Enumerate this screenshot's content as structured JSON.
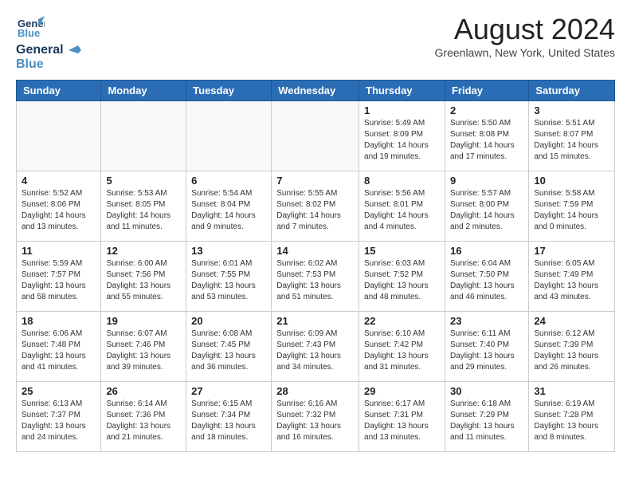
{
  "header": {
    "logo_line1": "General",
    "logo_line2": "Blue",
    "title": "August 2024",
    "subtitle": "Greenlawn, New York, United States"
  },
  "weekdays": [
    "Sunday",
    "Monday",
    "Tuesday",
    "Wednesday",
    "Thursday",
    "Friday",
    "Saturday"
  ],
  "weeks": [
    [
      {
        "day": "",
        "info": "",
        "empty": true
      },
      {
        "day": "",
        "info": "",
        "empty": true
      },
      {
        "day": "",
        "info": "",
        "empty": true
      },
      {
        "day": "",
        "info": "",
        "empty": true
      },
      {
        "day": "1",
        "info": "Sunrise: 5:49 AM\nSunset: 8:09 PM\nDaylight: 14 hours\nand 19 minutes."
      },
      {
        "day": "2",
        "info": "Sunrise: 5:50 AM\nSunset: 8:08 PM\nDaylight: 14 hours\nand 17 minutes."
      },
      {
        "day": "3",
        "info": "Sunrise: 5:51 AM\nSunset: 8:07 PM\nDaylight: 14 hours\nand 15 minutes."
      }
    ],
    [
      {
        "day": "4",
        "info": "Sunrise: 5:52 AM\nSunset: 8:06 PM\nDaylight: 14 hours\nand 13 minutes."
      },
      {
        "day": "5",
        "info": "Sunrise: 5:53 AM\nSunset: 8:05 PM\nDaylight: 14 hours\nand 11 minutes."
      },
      {
        "day": "6",
        "info": "Sunrise: 5:54 AM\nSunset: 8:04 PM\nDaylight: 14 hours\nand 9 minutes."
      },
      {
        "day": "7",
        "info": "Sunrise: 5:55 AM\nSunset: 8:02 PM\nDaylight: 14 hours\nand 7 minutes."
      },
      {
        "day": "8",
        "info": "Sunrise: 5:56 AM\nSunset: 8:01 PM\nDaylight: 14 hours\nand 4 minutes."
      },
      {
        "day": "9",
        "info": "Sunrise: 5:57 AM\nSunset: 8:00 PM\nDaylight: 14 hours\nand 2 minutes."
      },
      {
        "day": "10",
        "info": "Sunrise: 5:58 AM\nSunset: 7:59 PM\nDaylight: 14 hours\nand 0 minutes."
      }
    ],
    [
      {
        "day": "11",
        "info": "Sunrise: 5:59 AM\nSunset: 7:57 PM\nDaylight: 13 hours\nand 58 minutes."
      },
      {
        "day": "12",
        "info": "Sunrise: 6:00 AM\nSunset: 7:56 PM\nDaylight: 13 hours\nand 55 minutes."
      },
      {
        "day": "13",
        "info": "Sunrise: 6:01 AM\nSunset: 7:55 PM\nDaylight: 13 hours\nand 53 minutes."
      },
      {
        "day": "14",
        "info": "Sunrise: 6:02 AM\nSunset: 7:53 PM\nDaylight: 13 hours\nand 51 minutes."
      },
      {
        "day": "15",
        "info": "Sunrise: 6:03 AM\nSunset: 7:52 PM\nDaylight: 13 hours\nand 48 minutes."
      },
      {
        "day": "16",
        "info": "Sunrise: 6:04 AM\nSunset: 7:50 PM\nDaylight: 13 hours\nand 46 minutes."
      },
      {
        "day": "17",
        "info": "Sunrise: 6:05 AM\nSunset: 7:49 PM\nDaylight: 13 hours\nand 43 minutes."
      }
    ],
    [
      {
        "day": "18",
        "info": "Sunrise: 6:06 AM\nSunset: 7:48 PM\nDaylight: 13 hours\nand 41 minutes."
      },
      {
        "day": "19",
        "info": "Sunrise: 6:07 AM\nSunset: 7:46 PM\nDaylight: 13 hours\nand 39 minutes."
      },
      {
        "day": "20",
        "info": "Sunrise: 6:08 AM\nSunset: 7:45 PM\nDaylight: 13 hours\nand 36 minutes."
      },
      {
        "day": "21",
        "info": "Sunrise: 6:09 AM\nSunset: 7:43 PM\nDaylight: 13 hours\nand 34 minutes."
      },
      {
        "day": "22",
        "info": "Sunrise: 6:10 AM\nSunset: 7:42 PM\nDaylight: 13 hours\nand 31 minutes."
      },
      {
        "day": "23",
        "info": "Sunrise: 6:11 AM\nSunset: 7:40 PM\nDaylight: 13 hours\nand 29 minutes."
      },
      {
        "day": "24",
        "info": "Sunrise: 6:12 AM\nSunset: 7:39 PM\nDaylight: 13 hours\nand 26 minutes."
      }
    ],
    [
      {
        "day": "25",
        "info": "Sunrise: 6:13 AM\nSunset: 7:37 PM\nDaylight: 13 hours\nand 24 minutes."
      },
      {
        "day": "26",
        "info": "Sunrise: 6:14 AM\nSunset: 7:36 PM\nDaylight: 13 hours\nand 21 minutes."
      },
      {
        "day": "27",
        "info": "Sunrise: 6:15 AM\nSunset: 7:34 PM\nDaylight: 13 hours\nand 18 minutes."
      },
      {
        "day": "28",
        "info": "Sunrise: 6:16 AM\nSunset: 7:32 PM\nDaylight: 13 hours\nand 16 minutes."
      },
      {
        "day": "29",
        "info": "Sunrise: 6:17 AM\nSunset: 7:31 PM\nDaylight: 13 hours\nand 13 minutes."
      },
      {
        "day": "30",
        "info": "Sunrise: 6:18 AM\nSunset: 7:29 PM\nDaylight: 13 hours\nand 11 minutes."
      },
      {
        "day": "31",
        "info": "Sunrise: 6:19 AM\nSunset: 7:28 PM\nDaylight: 13 hours\nand 8 minutes."
      }
    ]
  ]
}
